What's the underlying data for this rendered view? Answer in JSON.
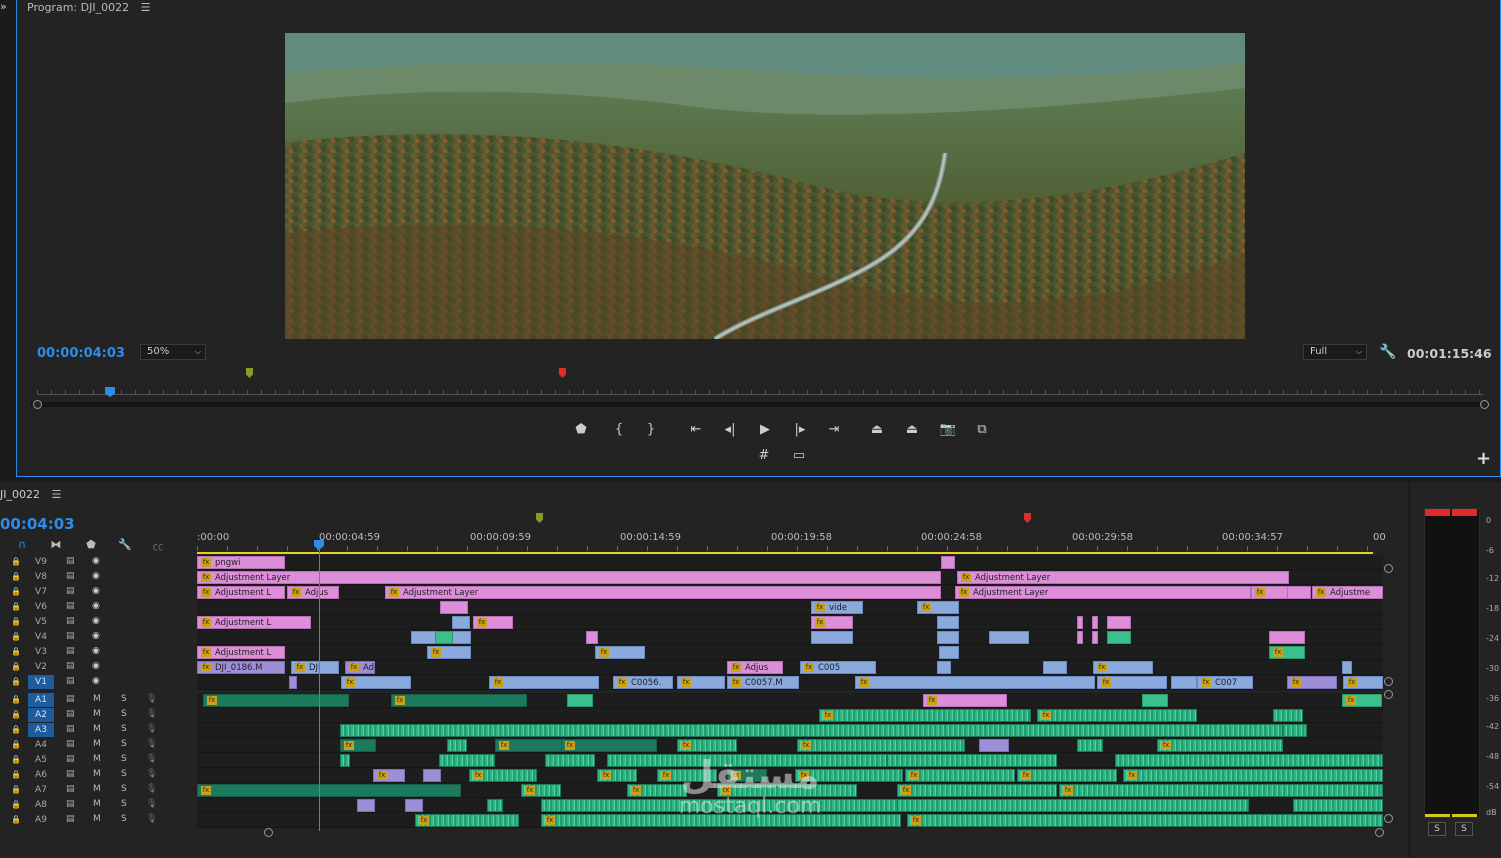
{
  "program": {
    "title": "Program: DJI_0022",
    "timecode_current": "00:00:04:03",
    "zoom": "50%",
    "quality": "Full",
    "duration": "00:01:15:46"
  },
  "timeline": {
    "sequence_name": "JI_0022",
    "timecode": "00:04:03",
    "ruler_labels": [
      ":00:00",
      "00:00:04:59",
      "00:00:09:59",
      "00:00:14:59",
      "00:00:19:58",
      "00:00:24:58",
      "00:00:29:58",
      "00:00:34:57",
      "00"
    ],
    "video_tracks": [
      "V9",
      "V8",
      "V7",
      "V6",
      "V5",
      "V4",
      "V3",
      "V2",
      "V1"
    ],
    "audio_tracks": [
      "A1",
      "A2",
      "A3",
      "A4",
      "A5",
      "A6",
      "A7",
      "A8",
      "A9"
    ],
    "mute_label": "M",
    "solo_label": "S",
    "clips": {
      "v9_a": "pngwi",
      "v8_a": "Adjustment Layer",
      "v8_b": "Adjustment Layer",
      "v7_a": "Adjustment L",
      "v7_b": "Adjus",
      "v7_c": "Adjustment Layer",
      "v7_d": "Adjustment Layer",
      "v7_e": "Adjustme",
      "v6_a": "vide",
      "v5_a": "Adjustment L",
      "v3_a": "Adjustment L",
      "v2_a": "DJI_0186.M",
      "v2_b": "DJI",
      "v2_c": "Adjus",
      "v2_d": "C005",
      "v1_a": "C0056.",
      "v1_b": "C0057.M",
      "v1_c": "C007"
    }
  },
  "meters": {
    "db_labels": [
      "0",
      "-6",
      "-12",
      "-18",
      "-24",
      "-30",
      "-36",
      "-42",
      "-48",
      "-54",
      "dB"
    ],
    "solo_left": "S",
    "solo_right": "S"
  },
  "watermark": {
    "arabic": "مستقل",
    "latin": "mostaql.com"
  },
  "colors": {
    "accent": "#2d8ceb",
    "adjustment_layer": "#dc8ed8",
    "video_clip": "#8aa9dc",
    "audio_clip": "#3bbf8b",
    "work_area": "#e8d21b",
    "in_marker": "#8a9a2a",
    "out_marker": "#e02b2b"
  }
}
